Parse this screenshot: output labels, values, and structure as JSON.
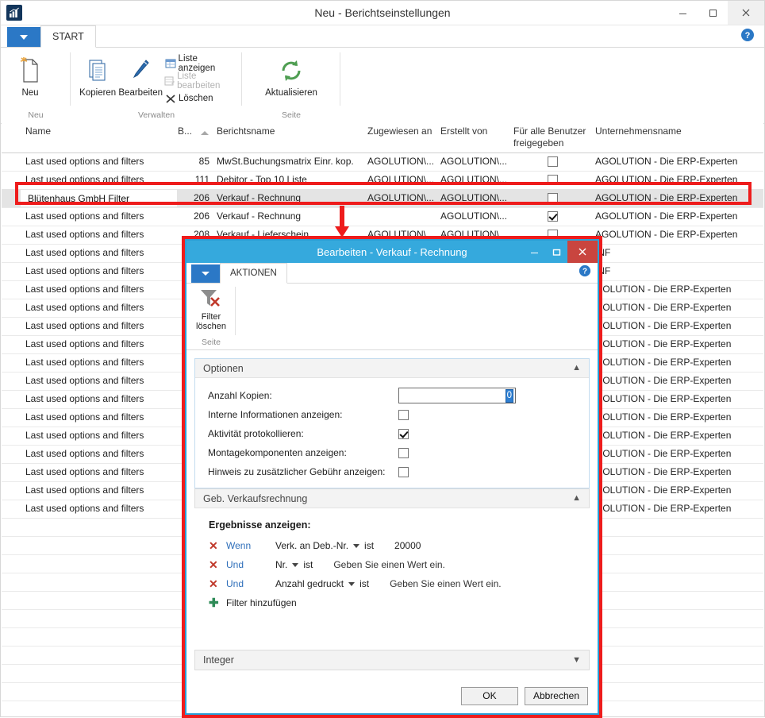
{
  "window": {
    "title": "Neu - Berichtseinstellungen",
    "app_icon": "chart-bar-icon",
    "minimize": "–",
    "maximize": "▢",
    "close": "✕"
  },
  "ribbon": {
    "app_menu_icon": "chevron-down-icon",
    "tab": "START",
    "help_icon": "help-icon",
    "groups": [
      {
        "label": "Neu",
        "buttons": [
          {
            "label": "Neu",
            "icon": "new-document-icon"
          }
        ]
      },
      {
        "label": "Verwalten",
        "buttons": [
          {
            "label": "Kopieren",
            "icon": "copy-icon"
          },
          {
            "label": "Bearbeiten",
            "icon": "pencil-icon"
          }
        ],
        "small_buttons": [
          {
            "label": "Liste anzeigen",
            "icon": "show-list-icon",
            "disabled": false
          },
          {
            "label": "Liste bearbeiten",
            "icon": "edit-list-icon",
            "disabled": true
          },
          {
            "label": "Löschen",
            "icon": "delete-x-icon",
            "disabled": false
          }
        ]
      },
      {
        "label": "Seite",
        "buttons": [
          {
            "label": "Aktualisieren",
            "icon": "refresh-icon"
          }
        ]
      }
    ]
  },
  "grid": {
    "columns": [
      {
        "key": "name",
        "label": "Name"
      },
      {
        "key": "b",
        "label": "B..."
      },
      {
        "key": "berichtsname",
        "label": "Berichtsname"
      },
      {
        "key": "zugewiesen",
        "label": "Zugewiesen an"
      },
      {
        "key": "erstellt",
        "label": "Erstellt von"
      },
      {
        "key": "freigegeben",
        "label": "Für alle Benutzer\nfreigegeben"
      },
      {
        "key": "unternehmen",
        "label": "Unternehmensname"
      }
    ],
    "sorted_column": "b",
    "sort_direction": "asc",
    "rows": [
      {
        "name": "Last used options and filters",
        "b": "85",
        "berichtsname": "MwSt.Buchungsmatrix Einr. kop.",
        "zugewiesen": "AGOLUTION\\...",
        "erstellt": "AGOLUTION\\...",
        "freigegeben": false,
        "unternehmen": "AGOLUTION - Die ERP-Experten"
      },
      {
        "name": "Last used options and filters",
        "b": "111",
        "berichtsname": "Debitor - Top 10 Liste",
        "zugewiesen": "AGOLUTION\\...",
        "erstellt": "AGOLUTION\\...",
        "freigegeben": false,
        "unternehmen": "AGOLUTION - Die ERP-Experten"
      },
      {
        "name": "Blütenhaus GmbH Filter",
        "b": "206",
        "berichtsname": "Verkauf - Rechnung",
        "zugewiesen": "AGOLUTION\\...",
        "erstellt": "AGOLUTION\\...",
        "freigegeben": false,
        "unternehmen": "AGOLUTION - Die ERP-Experten",
        "selected": true
      },
      {
        "name": "Last used options and filters",
        "b": "206",
        "berichtsname": "Verkauf - Rechnung",
        "zugewiesen": "",
        "erstellt": "AGOLUTION\\...",
        "freigegeben": true,
        "unternehmen": "AGOLUTION - Die ERP-Experten"
      },
      {
        "name": "Last used options and filters",
        "b": "208",
        "berichtsname": "Verkauf - Lieferschein",
        "zugewiesen": "AGOLUTION\\...",
        "erstellt": "AGOLUTION\\...",
        "freigegeben": false,
        "unternehmen": "AGOLUTION - Die ERP-Experten"
      },
      {
        "name": "Last used options and filters",
        "b": "",
        "berichtsname": "",
        "zugewiesen": "",
        "erstellt": "",
        "freigegeben": null,
        "unternehmen": "INF"
      },
      {
        "name": "Last used options and filters",
        "b": "",
        "berichtsname": "",
        "zugewiesen": "",
        "erstellt": "",
        "freigegeben": null,
        "unternehmen": "INF"
      },
      {
        "name": "Last used options and filters",
        "b": "",
        "berichtsname": "",
        "zugewiesen": "",
        "erstellt": "",
        "freigegeben": null,
        "unternehmen": "GOLUTION - Die ERP-Experten"
      },
      {
        "name": "Last used options and filters",
        "b": "",
        "berichtsname": "",
        "zugewiesen": "",
        "erstellt": "",
        "freigegeben": null,
        "unternehmen": "GOLUTION - Die ERP-Experten"
      },
      {
        "name": "Last used options and filters",
        "b": "",
        "berichtsname": "",
        "zugewiesen": "",
        "erstellt": "",
        "freigegeben": null,
        "unternehmen": "GOLUTION - Die ERP-Experten"
      },
      {
        "name": "Last used options and filters",
        "b": "",
        "berichtsname": "",
        "zugewiesen": "",
        "erstellt": "",
        "freigegeben": null,
        "unternehmen": "GOLUTION - Die ERP-Experten"
      },
      {
        "name": "Last used options and filters",
        "b": "",
        "berichtsname": "",
        "zugewiesen": "",
        "erstellt": "",
        "freigegeben": null,
        "unternehmen": "GOLUTION - Die ERP-Experten"
      },
      {
        "name": "Last used options and filters",
        "b": "",
        "berichtsname": "",
        "zugewiesen": "",
        "erstellt": "",
        "freigegeben": null,
        "unternehmen": "GOLUTION - Die ERP-Experten"
      },
      {
        "name": "Last used options and filters",
        "b": "",
        "berichtsname": "",
        "zugewiesen": "",
        "erstellt": "",
        "freigegeben": null,
        "unternehmen": "GOLUTION - Die ERP-Experten"
      },
      {
        "name": "Last used options and filters",
        "b": "",
        "berichtsname": "",
        "zugewiesen": "",
        "erstellt": "",
        "freigegeben": null,
        "unternehmen": "GOLUTION - Die ERP-Experten"
      },
      {
        "name": "Last used options and filters",
        "b": "",
        "berichtsname": "",
        "zugewiesen": "",
        "erstellt": "",
        "freigegeben": null,
        "unternehmen": "GOLUTION - Die ERP-Experten"
      },
      {
        "name": "Last used options and filters",
        "b": "",
        "berichtsname": "",
        "zugewiesen": "",
        "erstellt": "",
        "freigegeben": null,
        "unternehmen": "GOLUTION - Die ERP-Experten"
      },
      {
        "name": "Last used options and filters",
        "b": "",
        "berichtsname": "",
        "zugewiesen": "",
        "erstellt": "",
        "freigegeben": null,
        "unternehmen": "GOLUTION - Die ERP-Experten"
      },
      {
        "name": "Last used options and filters",
        "b": "",
        "berichtsname": "",
        "zugewiesen": "",
        "erstellt": "",
        "freigegeben": null,
        "unternehmen": "GOLUTION - Die ERP-Experten"
      },
      {
        "name": "Last used options and filters",
        "b": "",
        "berichtsname": "",
        "zugewiesen": "",
        "erstellt": "",
        "freigegeben": null,
        "unternehmen": "GOLUTION - Die ERP-Experten"
      },
      {
        "name": "",
        "b": "",
        "berichtsname": "",
        "zugewiesen": "",
        "erstellt": "",
        "freigegeben": null,
        "unternehmen": ""
      },
      {
        "name": "",
        "b": "",
        "berichtsname": "",
        "zugewiesen": "",
        "erstellt": "",
        "freigegeben": null,
        "unternehmen": ""
      },
      {
        "name": "",
        "b": "",
        "berichtsname": "",
        "zugewiesen": "",
        "erstellt": "",
        "freigegeben": null,
        "unternehmen": ""
      },
      {
        "name": "",
        "b": "",
        "berichtsname": "",
        "zugewiesen": "",
        "erstellt": "",
        "freigegeben": null,
        "unternehmen": ""
      },
      {
        "name": "",
        "b": "",
        "berichtsname": "",
        "zugewiesen": "",
        "erstellt": "",
        "freigegeben": null,
        "unternehmen": ""
      },
      {
        "name": "",
        "b": "",
        "berichtsname": "",
        "zugewiesen": "",
        "erstellt": "",
        "freigegeben": null,
        "unternehmen": ""
      },
      {
        "name": "",
        "b": "",
        "berichtsname": "",
        "zugewiesen": "",
        "erstellt": "",
        "freigegeben": null,
        "unternehmen": ""
      },
      {
        "name": "",
        "b": "",
        "berichtsname": "",
        "zugewiesen": "",
        "erstellt": "",
        "freigegeben": null,
        "unternehmen": ""
      },
      {
        "name": "",
        "b": "",
        "berichtsname": "",
        "zugewiesen": "",
        "erstellt": "",
        "freigegeben": null,
        "unternehmen": ""
      },
      {
        "name": "",
        "b": "",
        "berichtsname": "",
        "zugewiesen": "",
        "erstellt": "",
        "freigegeben": null,
        "unternehmen": ""
      },
      {
        "name": "",
        "b": "",
        "berichtsname": "",
        "zugewiesen": "",
        "erstellt": "",
        "freigegeben": null,
        "unternehmen": ""
      }
    ]
  },
  "annotations": {
    "highlight_color": "#ee1c1c",
    "arrow_direction": "down"
  },
  "dialog": {
    "title": "Bearbeiten - Verkauf - Rechnung",
    "minimize": "–",
    "maximize": "▢",
    "close": "✕",
    "app_menu_icon": "chevron-down-icon",
    "tab": "AKTIONEN",
    "help_icon": "help-icon",
    "ribbon": {
      "group_label": "Seite",
      "button": {
        "label_line1": "Filter",
        "label_line2": "löschen",
        "icon": "clear-filter-icon"
      }
    },
    "options_section": {
      "title": "Optionen",
      "chevron": "chevron-up-icon",
      "fields": [
        {
          "label": "Anzahl Kopien:",
          "type": "number",
          "value": "0",
          "selected": true
        },
        {
          "label": "Interne Informationen anzeigen:",
          "type": "checkbox",
          "checked": false
        },
        {
          "label": "Aktivität protokollieren:",
          "type": "checkbox",
          "checked": true
        },
        {
          "label": "Montagekomponenten anzeigen:",
          "type": "checkbox",
          "checked": false
        },
        {
          "label": "Hinweis zu zusätzlicher Gebühr anzeigen:",
          "type": "checkbox",
          "checked": false
        }
      ]
    },
    "filter_section": {
      "title": "Geb. Verkaufsrechnung",
      "chevron": "chevron-up-icon",
      "results_label": "Ergebnisse anzeigen:",
      "filters": [
        {
          "remove_icon": "x-icon",
          "conjunction": "Wenn",
          "field": "Verk. an Deb.-Nr.",
          "dropdown_icon": "chevron-down-icon",
          "operator": "ist",
          "value": "20000"
        },
        {
          "remove_icon": "x-icon",
          "conjunction": "Und",
          "field": "Nr.",
          "dropdown_icon": "chevron-down-icon",
          "operator": "ist",
          "value": "Geben Sie einen Wert ein."
        },
        {
          "remove_icon": "x-icon",
          "conjunction": "Und",
          "field": "Anzahl gedruckt",
          "dropdown_icon": "chevron-down-icon",
          "operator": "ist",
          "value": "Geben Sie einen Wert ein."
        }
      ],
      "add_filter": {
        "icon": "plus-icon",
        "label": "Filter hinzufügen"
      }
    },
    "integer_section": {
      "title": "Integer",
      "chevron": "chevron-down-icon"
    },
    "footer": {
      "ok": "OK",
      "cancel": "Abbrechen"
    }
  }
}
